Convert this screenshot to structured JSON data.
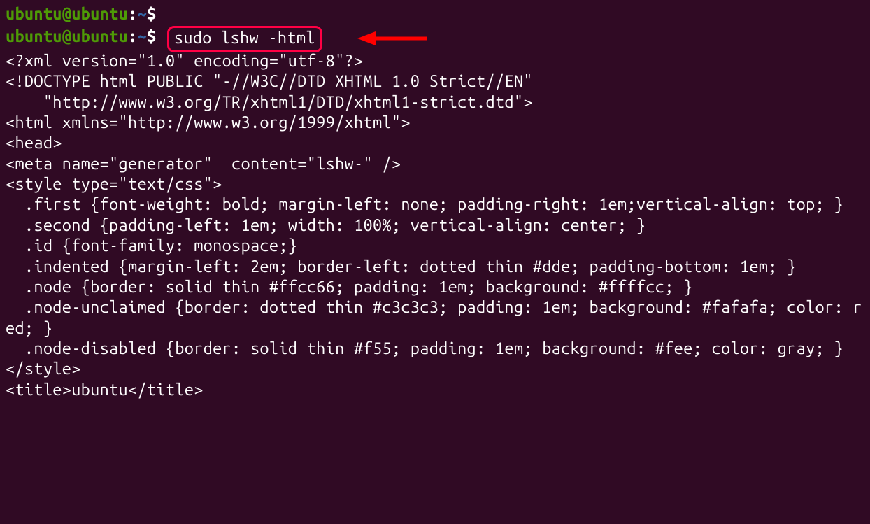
{
  "prompt": {
    "user": "ubuntu@ubuntu",
    "sep": ":",
    "path": "~",
    "dollar": "$"
  },
  "commands": {
    "line1_cmd": "",
    "line2_cmd": "sudo lshw -html"
  },
  "output": {
    "l1": "<?xml version=\"1.0\" encoding=\"utf-8\"?>",
    "l2": "<!DOCTYPE html PUBLIC \"-//W3C//DTD XHTML 1.0 Strict//EN\"",
    "l3": "    \"http://www.w3.org/TR/xhtml1/DTD/xhtml1-strict.dtd\">",
    "l4": "<html xmlns=\"http://www.w3.org/1999/xhtml\">",
    "l5": "<head>",
    "l6": "<meta name=\"generator\"  content=\"lshw-\" />",
    "l7": "<style type=\"text/css\">",
    "l8": "  .first {font-weight: bold; margin-left: none; padding-right: 1em;vertical-align: top; }",
    "l9": "  .second {padding-left: 1em; width: 100%; vertical-align: center; }",
    "l10": "  .id {font-family: monospace;}",
    "l11": "  .indented {margin-left: 2em; border-left: dotted thin #dde; padding-bottom: 1em; }",
    "l12": "  .node {border: solid thin #ffcc66; padding: 1em; background: #ffffcc; }",
    "l13": "  .node-unclaimed {border: dotted thin #c3c3c3; padding: 1em; background: #fafafa; color: red; }",
    "l14": "  .node-disabled {border: solid thin #f55; padding: 1em; background: #fee; color: gray; }",
    "l15": "</style>",
    "l16": "<title>ubuntu</title>"
  }
}
